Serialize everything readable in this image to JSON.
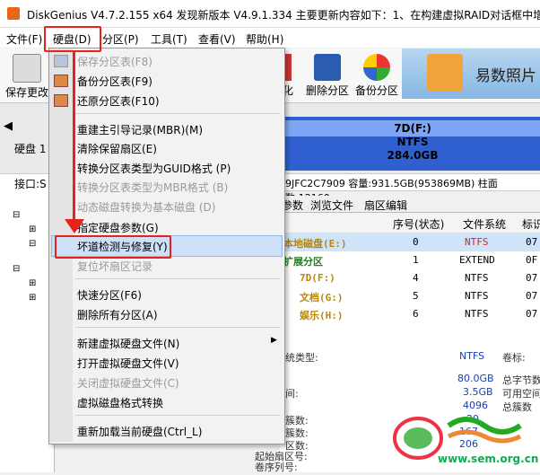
{
  "window": {
    "title": "DiskGenius V4.7.2.155 x64    发现新版本 V4.9.1.334 主要更新内容如下：1、在构建虚拟RAID对话框中增"
  },
  "menubar": {
    "items": [
      "文件(F)",
      "硬盘(D)",
      "分区(P)",
      "工具(T)",
      "查看(V)",
      "帮助(H)"
    ]
  },
  "toolbar": {
    "save_label": "保存更改",
    "partial_label": "化",
    "delete_partition_label": "删除分区",
    "backup_partition_label": "备份分区",
    "ad_text": "易数照片"
  },
  "disk_panel": {
    "disk_label": "硬盘 1",
    "interface_label": "接口:S",
    "partition_name": "7D(F:)",
    "partition_fs": "NTFS",
    "partition_size": "284.0GB",
    "info_line": "9JFC2C7909  容量:931.5GB(953869MB)  柱面数:12160"
  },
  "tabs": [
    "参数",
    "浏览文件",
    "扇区编辑"
  ],
  "partition_table": {
    "headers": [
      "序号(状态)",
      "文件系统",
      "标识"
    ],
    "rows": [
      {
        "name": "本地磁盘(E:)",
        "index": "0",
        "fs": "NTFS",
        "id": "07"
      },
      {
        "name": "扩展分区",
        "index": "1",
        "fs": "EXTEND",
        "id": "0F"
      },
      {
        "name": "7D(F:)",
        "index": "4",
        "fs": "NTFS",
        "id": "07"
      },
      {
        "name": "文档(G:)",
        "index": "5",
        "fs": "NTFS",
        "id": "07"
      },
      {
        "name": "娱乐(H:)",
        "index": "6",
        "fs": "NTFS",
        "id": "07"
      }
    ]
  },
  "details": {
    "fs_type_label": "统类型:",
    "fs_type_value": "NTFS",
    "volume_label": "卷标:",
    "total_bytes_label": "总字节数",
    "total_size": "80.0GB",
    "free_label": "可用空间",
    "free_size": "3.5GB",
    "cluster_label": "总簇数",
    "cluster_size": "4096",
    "value_4": "20",
    "value_5": "167",
    "value_6": "206",
    "serial_label": "卷序列号:",
    "rows_labels": [
      "间:",
      "簇数:",
      "簇数:",
      "区数:",
      "起始扇区号:"
    ]
  },
  "dropdown": {
    "items": [
      {
        "label": "保存分区表(F8)",
        "disabled": true
      },
      {
        "label": "备份分区表(F9)",
        "disabled": false
      },
      {
        "label": "还原分区表(F10)",
        "disabled": false
      },
      {
        "label": "重建主引导记录(MBR)(M)",
        "disabled": false
      },
      {
        "label": "清除保留扇区(E)",
        "disabled": false
      },
      {
        "label": "转换分区表类型为GUID格式 (P)",
        "disabled": false
      },
      {
        "label": "转换分区表类型为MBR格式 (B)",
        "disabled": true
      },
      {
        "label": "动态磁盘转换为基本磁盘 (D)",
        "disabled": true
      },
      {
        "label": "指定硬盘参数(G)",
        "disabled": false
      },
      {
        "label": "坏道检测与修复(Y)",
        "disabled": false
      },
      {
        "label": "复位坏扇区记录",
        "disabled": true
      },
      {
        "label": "快速分区(F6)",
        "disabled": false
      },
      {
        "label": "删除所有分区(A)",
        "disabled": false
      },
      {
        "label": "新建虚拟硬盘文件(N)",
        "disabled": false
      },
      {
        "label": "打开虚拟硬盘文件(V)",
        "disabled": false
      },
      {
        "label": "关闭虚拟硬盘文件(C)",
        "disabled": true
      },
      {
        "label": "虚拟磁盘格式转换",
        "disabled": false
      },
      {
        "label": "重新加载当前硬盘(Ctrl_L)",
        "disabled": false
      }
    ]
  },
  "watermark": {
    "url": "www.sem.org.cn"
  },
  "colors": {
    "accent_red": "#e8211b",
    "selected_row": "#cfe3f9",
    "partition_blue": "#3060d0"
  }
}
